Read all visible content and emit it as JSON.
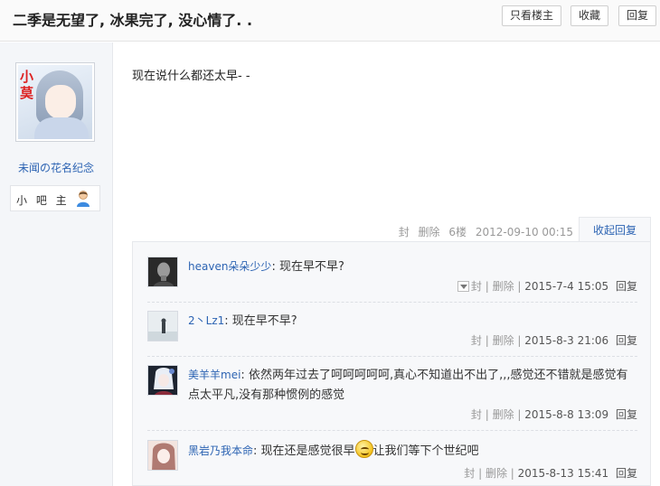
{
  "header": {
    "title": "二季是无望了, 冰果完了, 没心情了. .",
    "buttons": {
      "only_op": "只看楼主",
      "favorite": "收藏",
      "reply": "回复"
    }
  },
  "author": {
    "name": "未闻の花名纪念",
    "avatar_text": "小莫",
    "role": "小 吧 主"
  },
  "post": {
    "content": "现在说什么都还太早- -",
    "meta": {
      "ban": "封",
      "delete": "删除",
      "floor": "6楼",
      "time": "2012-09-10 00:15"
    },
    "collapse_label": "收起回复"
  },
  "replies": [
    {
      "user": "heaven朵朵少少",
      "text": "现在早不早?",
      "actions": "封 | 删除 |",
      "time": "2015-7-4 15:05",
      "reply": "回复"
    },
    {
      "user": "2丶Lz1",
      "text": "现在早不早?",
      "actions": "封 | 删除 |",
      "time": "2015-8-3 21:06",
      "reply": "回复"
    },
    {
      "user": "美羊羊mei",
      "text": "依然两年过去了呵呵呵呵呵,真心不知道出不出了,,,感觉还不错就是感觉有点太平凡,没有那种惯例的感觉",
      "actions": "封 | 删除 |",
      "time": "2015-8-8 13:09",
      "reply": "回复"
    },
    {
      "user": "黑岩乃我本命",
      "text": "现在还是感觉很早",
      "text_after": "让我们等下个世纪吧",
      "actions": "封 | 删除 |",
      "time": "2015-8-13 15:41",
      "reply": "回复"
    }
  ],
  "colors": {
    "link": "#2d64b3",
    "meta": "#999999",
    "panel": "#f7f8fa"
  }
}
